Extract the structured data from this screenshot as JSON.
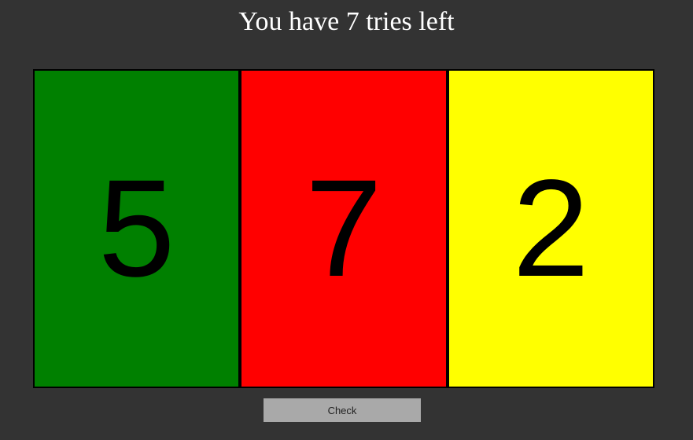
{
  "status": {
    "tries_text": "You have 7 tries left"
  },
  "digits": [
    {
      "value": "5",
      "color": "#008000"
    },
    {
      "value": "7",
      "color": "#ff0000"
    },
    {
      "value": "2",
      "color": "#ffff00"
    }
  ],
  "controls": {
    "check_label": "Check",
    "check_color": "#a9a9a9"
  },
  "theme": {
    "background": "#333333"
  }
}
